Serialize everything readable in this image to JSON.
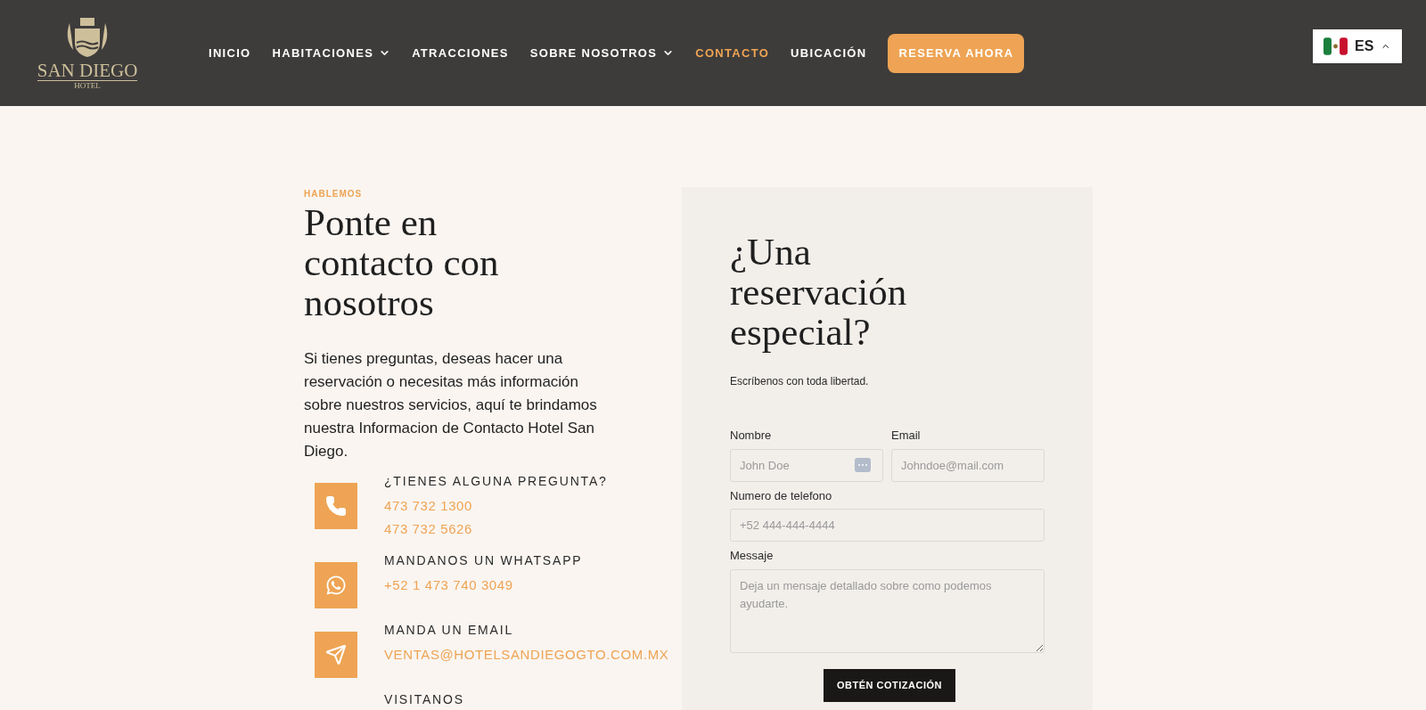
{
  "logo": {
    "name": "SAN DIEGO",
    "subtitle": "HOTEL"
  },
  "nav": [
    {
      "label": "INICIO",
      "selected": false,
      "dropdown": false
    },
    {
      "label": "HABITACIONES",
      "selected": false,
      "dropdown": true
    },
    {
      "label": "ATRACCIONES",
      "selected": false,
      "dropdown": false
    },
    {
      "label": "SOBRE NOSOTROS",
      "selected": false,
      "dropdown": true
    },
    {
      "label": "CONTACTO",
      "selected": true,
      "dropdown": false
    },
    {
      "label": "UBICACIÓN",
      "selected": false,
      "dropdown": false
    }
  ],
  "cta": "RESERVA AHORA",
  "language": {
    "code": "ES",
    "expanded": true
  },
  "contact": {
    "eyebrow": "HABLEMOS",
    "title": "Ponte en contacto con nosotros",
    "intro": "Si tienes preguntas, deseas hacer una reservación o necesitas más información sobre nuestros servicios, aquí te brindamos nuestra Informacion de Contacto Hotel San Diego.",
    "items": [
      {
        "kind": "phone",
        "heading": "¿TIENES ALGUNA PREGUNTA?",
        "links": [
          "473 732 1300",
          "473 732 5626"
        ]
      },
      {
        "kind": "whatsapp",
        "heading": "MANDANOS UN WHATSAPP",
        "links": [
          "+52 1 473 740 3049"
        ]
      },
      {
        "kind": "email",
        "heading": "MANDA UN EMAIL",
        "links": [
          "VENTAS@HOTELSANDIEGOGTO.COM.MX"
        ]
      },
      {
        "kind": "none",
        "heading": "VISITANOS"
      }
    ]
  },
  "form": {
    "title": "¿Una reservación especial?",
    "subtitle": "Escríbenos con toda libertad.",
    "fields": [
      {
        "label": "Nombre",
        "placeholder": "John Doe"
      },
      {
        "label": "Email",
        "placeholder": "Johndoe@mail.com"
      },
      {
        "label": "Numero de telefono",
        "placeholder": "+52 444-444-4444"
      },
      {
        "label": "Messaje",
        "placeholder": "Deja un mensaje detallado sobre como podemos ayudarte."
      }
    ],
    "submit": "OBTÉN COTIZACIÓN"
  }
}
